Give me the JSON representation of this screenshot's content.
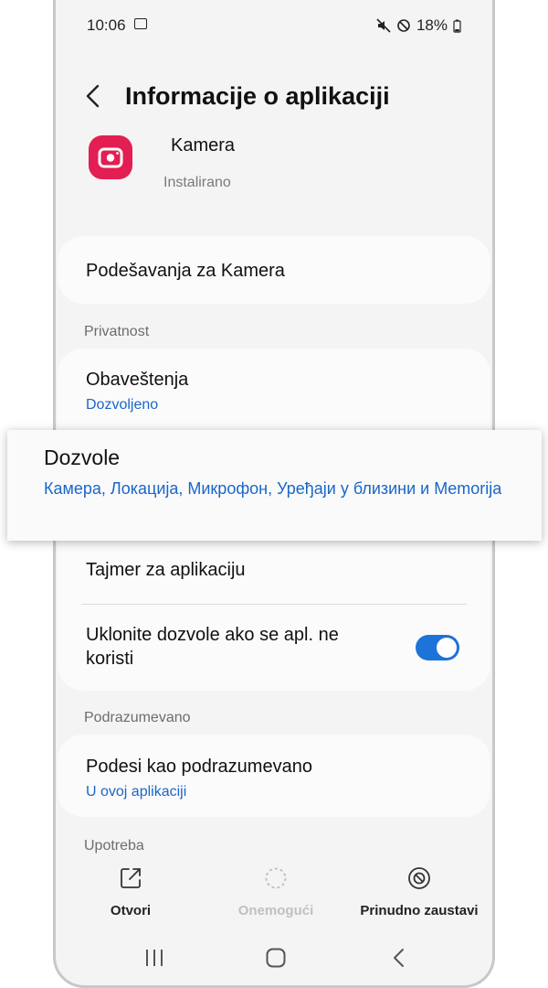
{
  "status_bar": {
    "time": "10:06",
    "battery": "18%"
  },
  "header": {
    "title": "Informacije o aplikaciji"
  },
  "app": {
    "name": "Kamera",
    "status": "Instalirano"
  },
  "settings_card": {
    "label": "Podešavanja za Kamera"
  },
  "privacy": {
    "section_label": "Privatnost",
    "notifications": {
      "title": "Obaveštenja",
      "subtitle": "Dozvoljeno"
    },
    "permissions": {
      "title": "Dozvole",
      "subtitle": "Камера, Локација, Микрофон, Уређаји у близини и Memorija"
    },
    "app_timer": {
      "title": "Tajmer za aplikaciju"
    },
    "remove_permissions": {
      "title_line1": "Uklonite dozvole ako se apl. ne",
      "title_line2": "koristi",
      "enabled": true
    }
  },
  "defaults": {
    "section_label": "Podrazumevano",
    "set_default": {
      "title": "Podesi kao podrazumevano",
      "subtitle": "U ovoj aplikaciji"
    }
  },
  "usage": {
    "section_label": "Upotreba"
  },
  "actions": {
    "open": "Otvori",
    "disable": "Onemogući",
    "force_stop": "Prinudno zaustavi"
  },
  "colors": {
    "accent": "#1d73d8",
    "link": "#1a66c8",
    "app_icon": "#e31e52"
  },
  "icons": [
    "back-icon",
    "camera-app-icon",
    "open-external-icon",
    "disable-icon",
    "force-stop-icon",
    "recent-apps-icon",
    "home-icon",
    "nav-back-icon"
  ]
}
